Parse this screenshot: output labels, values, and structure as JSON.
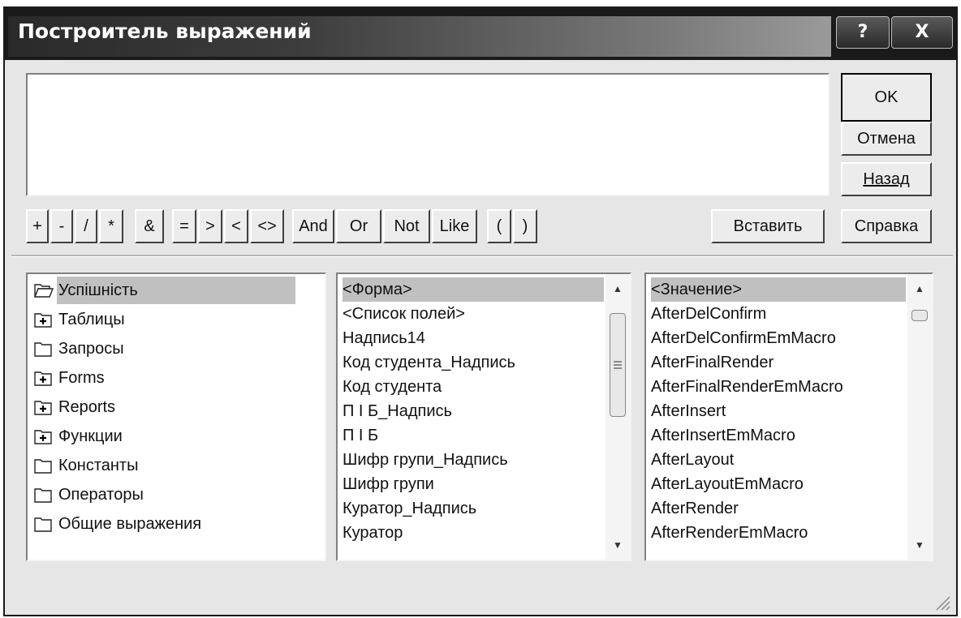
{
  "window": {
    "title": "Построитель выражений",
    "help_glyph": "?",
    "close_glyph": "X"
  },
  "expression": {
    "value": ""
  },
  "buttons": {
    "ok": "OK",
    "cancel": "Отмена",
    "back": "Назад",
    "help": "Справка",
    "paste": "Вставить"
  },
  "operators": [
    "+",
    "-",
    "/",
    "*",
    "&",
    "=",
    ">",
    "<",
    "<>",
    "And",
    "Or",
    "Not",
    "Like",
    "(",
    ")"
  ],
  "tree": {
    "items": [
      {
        "label": "Успішність",
        "icon": "folder-open-icon",
        "selected": true
      },
      {
        "label": "Таблицы",
        "icon": "plus-folder-icon"
      },
      {
        "label": "Запросы",
        "icon": "folder-icon"
      },
      {
        "label": "Forms",
        "icon": "plus-folder-icon"
      },
      {
        "label": "Reports",
        "icon": "plus-folder-icon"
      },
      {
        "label": "Функции",
        "icon": "plus-folder-icon"
      },
      {
        "label": "Константы",
        "icon": "folder-icon"
      },
      {
        "label": "Операторы",
        "icon": "folder-icon"
      },
      {
        "label": "Общие выражения",
        "icon": "folder-icon"
      }
    ]
  },
  "middle_list": {
    "items": [
      "<Форма>",
      "<Список полей>",
      "Надпись14",
      "Код студента_Надпись",
      "Код студента",
      "П І Б_Надпись",
      "П І Б",
      "Шифр групи_Надпись",
      "Шифр групи",
      "Куратор_Надпись",
      "Куратор"
    ],
    "selected_index": 0
  },
  "right_list": {
    "items": [
      "<Значение>",
      "AfterDelConfirm",
      "AfterDelConfirmEmMacro",
      "AfterFinalRender",
      "AfterFinalRenderEmMacro",
      "AfterInsert",
      "AfterInsertEmMacro",
      "AfterLayout",
      "AfterLayoutEmMacro",
      "AfterRender",
      "AfterRenderEmMacro"
    ],
    "selected_index": 0
  },
  "colors": {
    "selection": "#c0c0c0",
    "dialog_bg": "#e6e6e6",
    "titlebar": "#1a1a1a"
  }
}
